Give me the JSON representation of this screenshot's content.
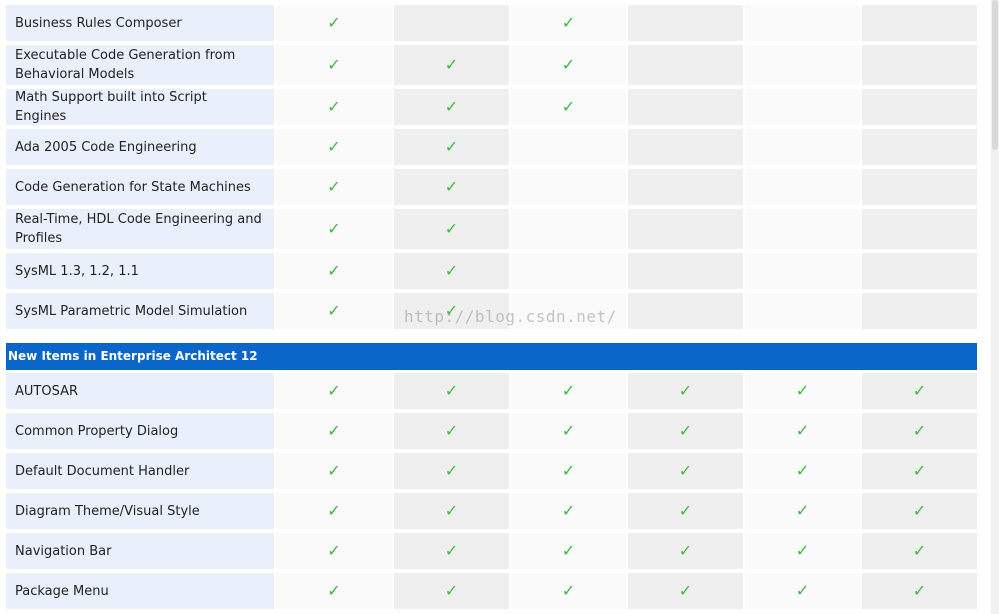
{
  "check_glyph": "✓",
  "check_color": "#3dbb3d",
  "header_color": "#0a66c9",
  "watermark": "http://blog.csdn.net/",
  "top_group": {
    "rows": [
      {
        "label": "Business Rules Composer",
        "checks": [
          true,
          false,
          true,
          false,
          false,
          false
        ]
      },
      {
        "label": "Executable Code Generation from Behavioral Models",
        "checks": [
          true,
          true,
          true,
          false,
          false,
          false
        ]
      },
      {
        "label": "Math Support built into Script Engines",
        "checks": [
          true,
          true,
          true,
          false,
          false,
          false
        ]
      },
      {
        "label": "Ada 2005 Code Engineering",
        "checks": [
          true,
          true,
          false,
          false,
          false,
          false
        ]
      },
      {
        "label": "Code Generation for State Machines",
        "checks": [
          true,
          true,
          false,
          false,
          false,
          false
        ]
      },
      {
        "label": "Real-Time, HDL Code Engineering and Profiles",
        "checks": [
          true,
          true,
          false,
          false,
          false,
          false
        ]
      },
      {
        "label": "SysML 1.3, 1.2, 1.1",
        "checks": [
          true,
          true,
          false,
          false,
          false,
          false
        ]
      },
      {
        "label": "SysML Parametric Model Simulation",
        "checks": [
          true,
          true,
          false,
          false,
          false,
          false
        ]
      }
    ]
  },
  "section": {
    "title": "New Items in Enterprise Architect 12"
  },
  "bottom_group": {
    "rows": [
      {
        "label": "AUTOSAR",
        "checks": [
          true,
          true,
          true,
          true,
          true,
          true
        ]
      },
      {
        "label": "Common Property Dialog",
        "checks": [
          true,
          true,
          true,
          true,
          true,
          true
        ]
      },
      {
        "label": "Default Document Handler",
        "checks": [
          true,
          true,
          true,
          true,
          true,
          true
        ]
      },
      {
        "label": "Diagram Theme/Visual Style",
        "checks": [
          true,
          true,
          true,
          true,
          true,
          true
        ]
      },
      {
        "label": "Navigation Bar",
        "checks": [
          true,
          true,
          true,
          true,
          true,
          true
        ]
      },
      {
        "label": "Package Menu",
        "checks": [
          true,
          true,
          true,
          true,
          true,
          true
        ]
      }
    ]
  }
}
